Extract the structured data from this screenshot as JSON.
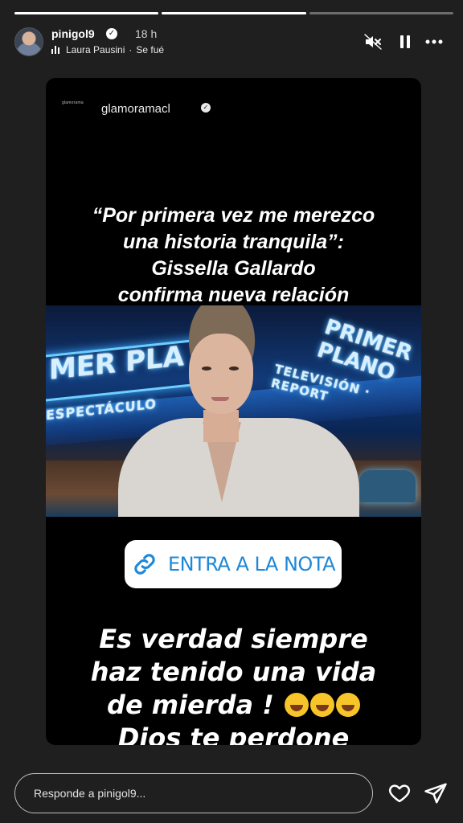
{
  "progress": [
    {
      "state": "viewed",
      "fill": 1.0
    },
    {
      "state": "current",
      "fill": 1.0
    },
    {
      "state": "upcoming",
      "fill": 0.0
    }
  ],
  "header": {
    "username": "pinigol9",
    "verified": true,
    "time": "18 h",
    "music": {
      "artist": "Laura Pausini",
      "separator": "·",
      "song": "Se fué"
    },
    "icons": [
      "mute-icon",
      "pause-icon",
      "more-icon"
    ]
  },
  "story": {
    "source_logo_text": "glamorama",
    "source_account": "glamoramacl",
    "headline": [
      "“Por primera vez me merezco",
      "una historia tranquila”:",
      "Gissella Gallardo",
      "confirma nueva relación"
    ],
    "photo": {
      "neon_texts": [
        "MER PLA",
        "PRIMER PLANO",
        "ESPECTÁCULO",
        "TELEVISIÓN · REPORT"
      ]
    },
    "link_button": {
      "icon": "link-icon",
      "label": "ENTRA A LA NOTA"
    },
    "comment": [
      "Es verdad siempre",
      "haz tenido una vida",
      "de mierda !",
      "Dios te perdone"
    ],
    "emojis": [
      "rolling-on-floor-laughing",
      "rolling-on-floor-laughing",
      "rolling-on-floor-laughing"
    ]
  },
  "footer": {
    "reply_placeholder": "Responde a pinigol9...",
    "icons": [
      "heart-icon",
      "send-icon"
    ]
  },
  "colors": {
    "background": "#1f1f1f",
    "link_blue": "#1e88d8",
    "card": "#000000"
  }
}
